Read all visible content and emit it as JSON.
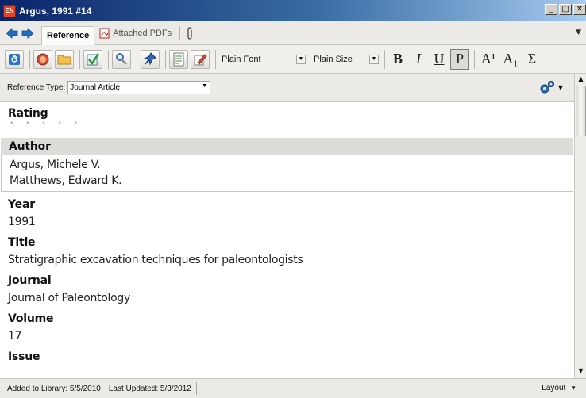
{
  "window": {
    "title": "Argus, 1991 #14",
    "app_icon_text": "EN",
    "minimize": "_",
    "maximize": "□",
    "close": "✕"
  },
  "tabs": {
    "reference": "Reference",
    "attached_pdfs": "Attached PDFs"
  },
  "toolbar": {
    "font": "Plain Font",
    "size": "Plain Size",
    "bold": "B",
    "italic": "I",
    "underline": "U",
    "plain": "P",
    "superscript": "A¹",
    "subscript": "A₁",
    "symbol": "Σ"
  },
  "reference_type": {
    "label": "Reference Type:",
    "value": "Journal Article"
  },
  "fields": {
    "rating_label": "Rating",
    "rating_dots": "• • • • •",
    "author_label": "Author",
    "authors": [
      "Argus, Michele V.",
      "Matthews, Edward K."
    ],
    "year_label": "Year",
    "year": "1991",
    "title_label": "Title",
    "title": "Stratigraphic excavation techniques for paleontologists",
    "journal_label": "Journal",
    "journal": "Journal of Paleontology",
    "volume_label": "Volume",
    "volume": "17",
    "issue_label": "Issue"
  },
  "status": {
    "added": "Added to Library: 5/5/2010",
    "updated": "Last Updated: 5/3/2012",
    "layout": "Layout"
  },
  "colors": {
    "titlebar_start": "#0a246a",
    "titlebar_end": "#a6caf0",
    "author_header_bg": "#dedcd8"
  }
}
